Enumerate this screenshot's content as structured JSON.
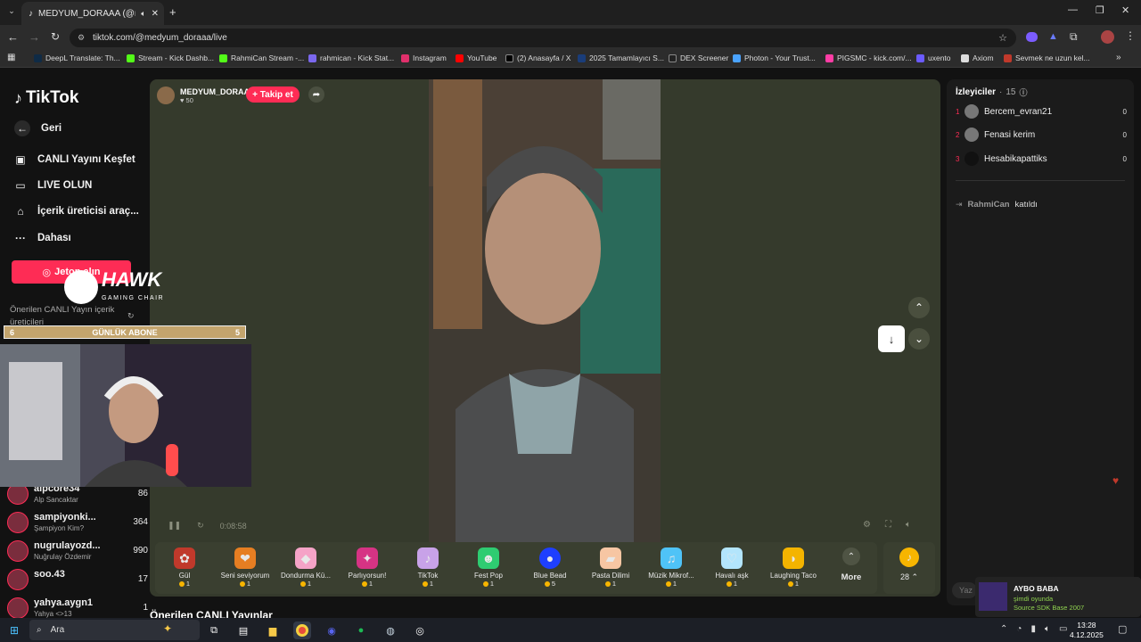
{
  "browser": {
    "tab_title": "MEDYUM_DORAAA (@med",
    "url": "tiktok.com/@medyum_doraaa/live",
    "bookmarks": [
      {
        "label": "DeepL Translate: Th...",
        "color": "#0f2b46"
      },
      {
        "label": "Stream - Kick Dashb...",
        "color": "#53fc18"
      },
      {
        "label": "RahmiCan Stream -...",
        "color": "#53fc18"
      },
      {
        "label": "rahmican - Kick Stat...",
        "color": "#7b68ee"
      },
      {
        "label": "Instagram",
        "color": "#e1306c"
      },
      {
        "label": "YouTube",
        "color": "#ff0000"
      },
      {
        "label": "(2) Anasayfa / X",
        "color": "#000000"
      },
      {
        "label": "2025 Tamamlayıcı S...",
        "color": "#1a3d7a"
      },
      {
        "label": "DEX Screener",
        "color": "#222222"
      },
      {
        "label": "Photon - Your Trust...",
        "color": "#4aa3ff"
      },
      {
        "label": "PIGSMC - kick.com/...",
        "color": "#ff3da5"
      },
      {
        "label": "uxento",
        "color": "#6b5bff"
      },
      {
        "label": "Axiom",
        "color": "#dddddd"
      },
      {
        "label": "Sevmek ne uzun kel...",
        "color": "#c0392b"
      }
    ]
  },
  "sidebar": {
    "brand": "TikTok",
    "items": [
      {
        "label": "Geri",
        "icon": "arrow-left-icon"
      },
      {
        "label": "CANLI Yayını Keşfet",
        "icon": "live-calendar-icon"
      },
      {
        "label": "LIVE OLUN",
        "icon": "video-camera-icon"
      },
      {
        "label": "İçerik üreticisi araç...",
        "icon": "creator-tools-icon"
      },
      {
        "label": "Dahası",
        "icon": "more-dots-icon"
      }
    ],
    "jeton_button": "Jeton alın",
    "suggested_title": "Önerilen CANLI Yayın içerik üreticileri",
    "creators": [
      {
        "name": "alpcore34",
        "subtitle": "Alp Sancaktar",
        "count": "86"
      },
      {
        "name": "sampiyonki...",
        "subtitle": "Şampiyon Kim?",
        "count": "364"
      },
      {
        "name": "nugrulayozd...",
        "subtitle": "Nuğrulay Özdemir",
        "count": "990"
      },
      {
        "name": "soo.43",
        "subtitle": "",
        "count": "17"
      },
      {
        "name": "yahya.aygn1",
        "subtitle": "Yahya <>13",
        "count": "1"
      }
    ]
  },
  "overlay": {
    "hawk_title": "HAWK",
    "hawk_subtitle": "GAMING CHAIR",
    "abone_left": "6",
    "abone_label": "GÜNLÜK ABONE",
    "abone_right": "5"
  },
  "stream": {
    "host_name": "MEDYUM_DORAAA",
    "host_likes": "50",
    "follow_label": "+ Takip et",
    "elapsed": "0:08:58",
    "more_label": "More",
    "coin_count": "28",
    "below_title": "Önerilen CANLI Yayınlar",
    "gifts": [
      {
        "name": "Gül",
        "price": "1",
        "icon": "rose-gift-icon",
        "color": "#c0392b"
      },
      {
        "name": "Seni seviyorum",
        "price": "1",
        "icon": "love-gift-icon",
        "color": "#e67e22"
      },
      {
        "name": "Dondurma Kü...",
        "price": "1",
        "icon": "ice-cream-gift-icon",
        "color": "#f5a3c7"
      },
      {
        "name": "Parlıyorsun!",
        "price": "1",
        "icon": "shine-gift-icon",
        "color": "#d63384"
      },
      {
        "name": "TikTok",
        "price": "1",
        "icon": "tiktok-gift-icon",
        "color": "#c8a2e8"
      },
      {
        "name": "Fest Pop",
        "price": "1",
        "icon": "fest-pop-gift-icon",
        "color": "#2ecc71"
      },
      {
        "name": "Blue Bead",
        "price": "5",
        "icon": "blue-bead-gift-icon",
        "color": "#1e3fff"
      },
      {
        "name": "Pasta Dilimi",
        "price": "1",
        "icon": "cake-gift-icon",
        "color": "#f7c6a3"
      },
      {
        "name": "Müzik Mikrof...",
        "price": "1",
        "icon": "microphone-gift-icon",
        "color": "#4fc3f7"
      },
      {
        "name": "Havalı aşk",
        "price": "1",
        "icon": "cool-love-gift-icon",
        "color": "#b3e5fc"
      },
      {
        "name": "Laughing Taco",
        "price": "1",
        "icon": "taco-gift-icon",
        "color": "#f4b400"
      }
    ]
  },
  "viewers": {
    "title": "İzleyiciler",
    "count": "15",
    "list": [
      {
        "rank": "1",
        "name": "Bercem_evran21",
        "score": "0"
      },
      {
        "rank": "2",
        "name": "Fenasi kerim",
        "score": "0"
      },
      {
        "rank": "3",
        "name": "Hesabikapattiks",
        "score": "0"
      }
    ],
    "joined_user": "RahmiCan",
    "joined_text": "katıldı",
    "chat_placeholder": "Yaz"
  },
  "notification": {
    "title": "AYBO BABA",
    "status": "şimdi oyunda",
    "game": "Source SDK Base 2007"
  },
  "taskbar": {
    "search_label": "Ara",
    "time": "13:28",
    "date": "4.12.2025"
  }
}
